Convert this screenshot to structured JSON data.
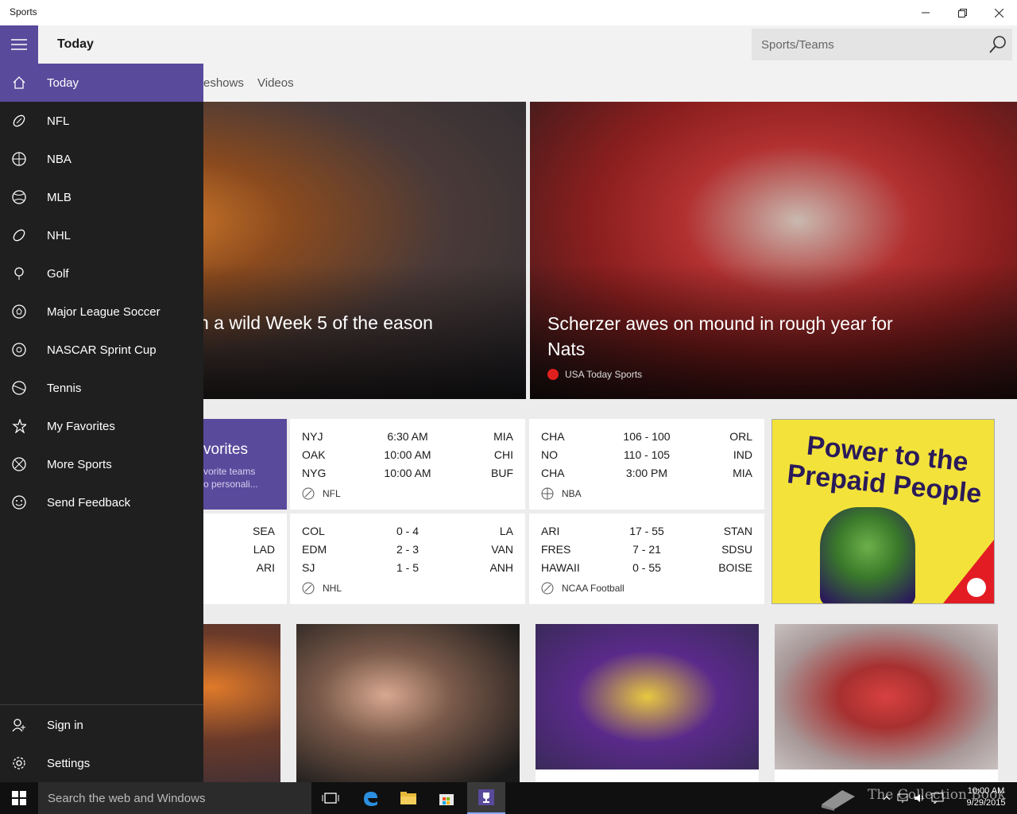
{
  "window": {
    "app_title": "Sports"
  },
  "header": {
    "title": "Today"
  },
  "search": {
    "placeholder": "Sports/Teams"
  },
  "tabs": [
    {
      "label": "eshows"
    },
    {
      "label": "Videos"
    }
  ],
  "heroes": [
    {
      "headline": "n a wild Week 5 of the eason"
    },
    {
      "headline": "Scherzer awes on mound in rough year for Nats",
      "source": "USA Today Sports"
    }
  ],
  "favorites_tile": {
    "title": "vorites",
    "subtitle_line1": "vorite teams",
    "subtitle_line2": "o personali..."
  },
  "scores": {
    "partial_card": {
      "rows": [
        "SEA",
        "LAD",
        "ARI"
      ]
    },
    "nfl": {
      "league": "NFL",
      "rows": [
        {
          "home": "NYJ",
          "mid": "6:30 AM",
          "away": "MIA"
        },
        {
          "home": "OAK",
          "mid": "10:00 AM",
          "away": "CHI"
        },
        {
          "home": "NYG",
          "mid": "10:00 AM",
          "away": "BUF"
        }
      ]
    },
    "nba": {
      "league": "NBA",
      "rows": [
        {
          "home": "CHA",
          "mid": "106  -  100",
          "away": "ORL"
        },
        {
          "home": "NO",
          "mid": "110  -  105",
          "away": "IND"
        },
        {
          "home": "CHA",
          "mid": "3:00 PM",
          "away": "MIA"
        }
      ]
    },
    "nhl": {
      "league": "NHL",
      "rows": [
        {
          "home": "COL",
          "mid": "0  -  4",
          "away": "LA"
        },
        {
          "home": "EDM",
          "mid": "2  -  3",
          "away": "VAN"
        },
        {
          "home": "SJ",
          "mid": "1  -  5",
          "away": "ANH"
        }
      ]
    },
    "ncaa": {
      "league": "NCAA Football",
      "rows": [
        {
          "home": "ARI",
          "mid": "17  -  55",
          "away": "STAN"
        },
        {
          "home": "FRES",
          "mid": "7  -  21",
          "away": "SDSU"
        },
        {
          "home": "HAWAII",
          "mid": "0  -  55",
          "away": "BOISE"
        }
      ]
    }
  },
  "ad": {
    "text": "Power to the Prepaid People"
  },
  "nav": {
    "items": [
      {
        "label": "Today",
        "icon": "home-icon"
      },
      {
        "label": "NFL",
        "icon": "football-icon"
      },
      {
        "label": "NBA",
        "icon": "basketball-icon"
      },
      {
        "label": "MLB",
        "icon": "baseball-icon"
      },
      {
        "label": "NHL",
        "icon": "hockey-icon"
      },
      {
        "label": "Golf",
        "icon": "golf-icon"
      },
      {
        "label": "Major League Soccer",
        "icon": "soccer-icon"
      },
      {
        "label": "NASCAR Sprint Cup",
        "icon": "nascar-icon"
      },
      {
        "label": "Tennis",
        "icon": "tennis-icon"
      },
      {
        "label": "My Favorites",
        "icon": "favorites-icon"
      },
      {
        "label": "More Sports",
        "icon": "more-sports-icon"
      },
      {
        "label": "Send Feedback",
        "icon": "feedback-icon"
      }
    ],
    "bottom": [
      {
        "label": "Sign in",
        "icon": "person-add-icon"
      },
      {
        "label": "Settings",
        "icon": "gear-icon"
      }
    ]
  },
  "taskbar": {
    "search_placeholder": "Search the web and Windows",
    "time": "10:00 AM",
    "date": "9/29/2015",
    "watermark": "The Collection Book"
  },
  "colors": {
    "accent": "#5a4a9c",
    "nav_bg": "#1f1f1f"
  }
}
